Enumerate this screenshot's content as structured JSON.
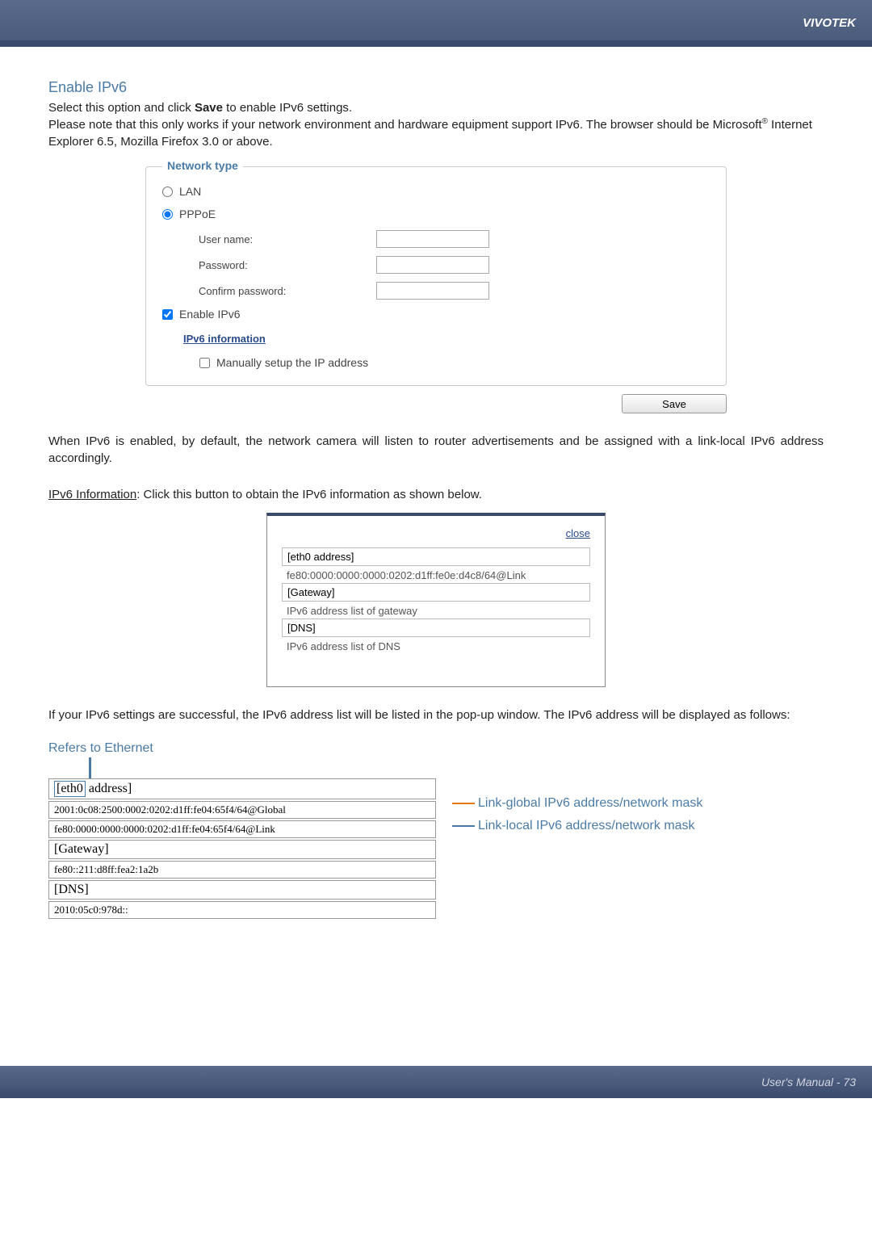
{
  "brand": "VIVOTEK",
  "section": {
    "title": "Enable IPv6",
    "intro1": "Select this option and click ",
    "intro1_bold": "Save",
    "intro1_end": " to enable IPv6 settings.",
    "intro2_a": "Please note that this only works if your network environment and hardware equipment support IPv6. The browser should be Microsoft",
    "intro2_sup": "®",
    "intro2_b": " Internet Explorer 6.5, Mozilla Firefox 3.0 or above."
  },
  "fieldset": {
    "legend": "Network type",
    "lan": "LAN",
    "pppoe": "PPPoE",
    "username": "User name:",
    "password": "Password:",
    "confirm": "Confirm password:",
    "enable_ipv6": "Enable IPv6",
    "ipv6_info_link": "IPv6 information",
    "manual": "Manually setup the IP address",
    "save": "Save"
  },
  "postfield": {
    "para1": "When IPv6 is enabled, by default, the network camera will listen to router advertisements and be assigned with a link-local IPv6 address accordingly.",
    "ipv6_info_label": "IPv6 Information",
    "ipv6_info_rest": ": Click this button to obtain the IPv6 information as shown below."
  },
  "popup": {
    "close": "close",
    "eth0": "[eth0 address]",
    "eth0_val": "fe80:0000:0000:0000:0202:d1ff:fe0e:d4c8/64@Link",
    "gateway": "[Gateway]",
    "gateway_val": "IPv6 address list of gateway",
    "dns": "[DNS]",
    "dns_val": "IPv6 address list of DNS"
  },
  "success_text": "If your IPv6 settings are successful, the IPv6 address list will be listed in the pop-up window. The IPv6 address will be displayed as follows:",
  "ethernet": {
    "title": "Refers to Ethernet",
    "eth0_label_a": "[eth0",
    "eth0_label_b": "address]",
    "global_addr": "2001:0c08:2500:0002:0202:d1ff:fe04:65f4/64@Global",
    "link_addr": "fe80:0000:0000:0000:0202:d1ff:fe04:65f4/64@Link",
    "gateway": "[Gateway]",
    "gateway_val": "fe80::211:d8ff:fea2:1a2b",
    "dns": "[DNS]",
    "dns_val": "2010:05c0:978d::",
    "global_label": "Link-global IPv6 address/network mask",
    "local_label": "Link-local IPv6 address/network mask"
  },
  "footer": "User's Manual - 73"
}
